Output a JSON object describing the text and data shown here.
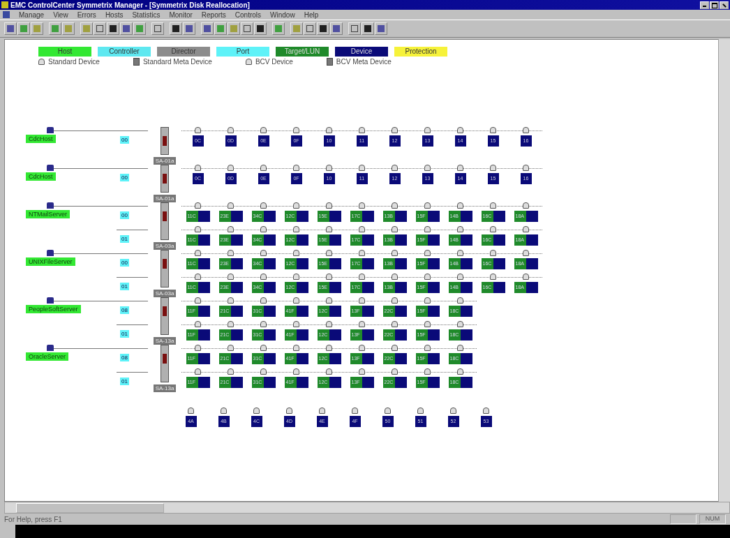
{
  "window": {
    "title": "EMC ControlCenter Symmetrix Manager - [Symmetrix Disk Reallocation]"
  },
  "menu": [
    "Manage",
    "View",
    "Errors",
    "Hosts",
    "Statistics",
    "Monitor",
    "Reports",
    "Controls",
    "Window",
    "Help"
  ],
  "legend": {
    "items": [
      {
        "label": "Host",
        "color": "#33e833"
      },
      {
        "label": "Controller",
        "color": "#5ee8f0"
      },
      {
        "label": "Director",
        "color": "#8c8c8c"
      },
      {
        "label": "Port",
        "color": "#5ef2f8"
      },
      {
        "label": "Target/LUN",
        "color": "#1f8a2a"
      },
      {
        "label": "Device",
        "color": "#0a0a78"
      },
      {
        "label": "Protection",
        "color": "#f6f23a"
      }
    ],
    "symbols": [
      {
        "label": "Standard Device",
        "kind": "standard"
      },
      {
        "label": "Standard Meta Device",
        "kind": "meta"
      },
      {
        "label": "BCV Device",
        "kind": "standard"
      },
      {
        "label": "BCV Meta Device",
        "kind": "meta"
      }
    ]
  },
  "groups": [
    {
      "host": "CdcHost",
      "director": "SA-01a",
      "paths": [
        {
          "port": "00",
          "kind": "device",
          "devices": [
            "0C",
            "0D",
            "0E",
            "0F",
            "10",
            "11",
            "12",
            "13",
            "14",
            "15",
            "16"
          ]
        }
      ]
    },
    {
      "host": "CdcHost",
      "director": "SA-01a",
      "paths": [
        {
          "port": "00",
          "kind": "device",
          "devices": [
            "0C",
            "0D",
            "0E",
            "0F",
            "10",
            "11",
            "12",
            "13",
            "14",
            "15",
            "16"
          ]
        }
      ]
    },
    {
      "host": "NTMailServer",
      "director": "SA-03a",
      "paths": [
        {
          "port": "00",
          "kind": "lun",
          "devices": [
            "11C",
            "23E",
            "34C",
            "12C",
            "15E",
            "17C",
            "13B",
            "15F",
            "14B",
            "16C",
            "18A"
          ]
        },
        {
          "port": "01",
          "kind": "lun",
          "devices": [
            "11C",
            "23E",
            "34C",
            "12C",
            "15E",
            "17C",
            "13B",
            "15F",
            "14B",
            "16C",
            "18A"
          ]
        }
      ]
    },
    {
      "host": "UNIXFileServer",
      "director": "SA-03a",
      "paths": [
        {
          "port": "00",
          "kind": "lun",
          "devices": [
            "11C",
            "23E",
            "34C",
            "12C",
            "15E",
            "17C",
            "13B",
            "15F",
            "14B",
            "16C",
            "18A"
          ]
        },
        {
          "port": "01",
          "kind": "lun",
          "devices": [
            "11C",
            "23E",
            "34C",
            "12C",
            "15E",
            "17C",
            "13B",
            "15F",
            "14B",
            "16C",
            "18A"
          ]
        }
      ]
    },
    {
      "host": "PeopleSoftServer",
      "director": "SA-13a",
      "paths": [
        {
          "port": "08",
          "kind": "lun",
          "devices": [
            "11F",
            "21C",
            "31C",
            "41F",
            "12C",
            "13F",
            "22C",
            "15F",
            "18C"
          ]
        },
        {
          "port": "01",
          "kind": "lun",
          "devices": [
            "11F",
            "21C",
            "31C",
            "41F",
            "12C",
            "13F",
            "22C",
            "15F",
            "18C"
          ]
        }
      ]
    },
    {
      "host": "OracleServer",
      "director": "SA-13a",
      "paths": [
        {
          "port": "08",
          "kind": "lun",
          "devices": [
            "11F",
            "21C",
            "31C",
            "41F",
            "12C",
            "13F",
            "22C",
            "15F",
            "18C"
          ]
        },
        {
          "port": "01",
          "kind": "lun",
          "devices": [
            "11F",
            "21C",
            "31C",
            "41F",
            "12C",
            "13F",
            "22C",
            "15F",
            "18C"
          ]
        }
      ]
    }
  ],
  "free_devices": [
    "4A",
    "4B",
    "4C",
    "4D",
    "4E",
    "4F",
    "50",
    "51",
    "52",
    "53"
  ],
  "status_bar": {
    "message": "For Help, press F1",
    "indicator": "NUM"
  }
}
